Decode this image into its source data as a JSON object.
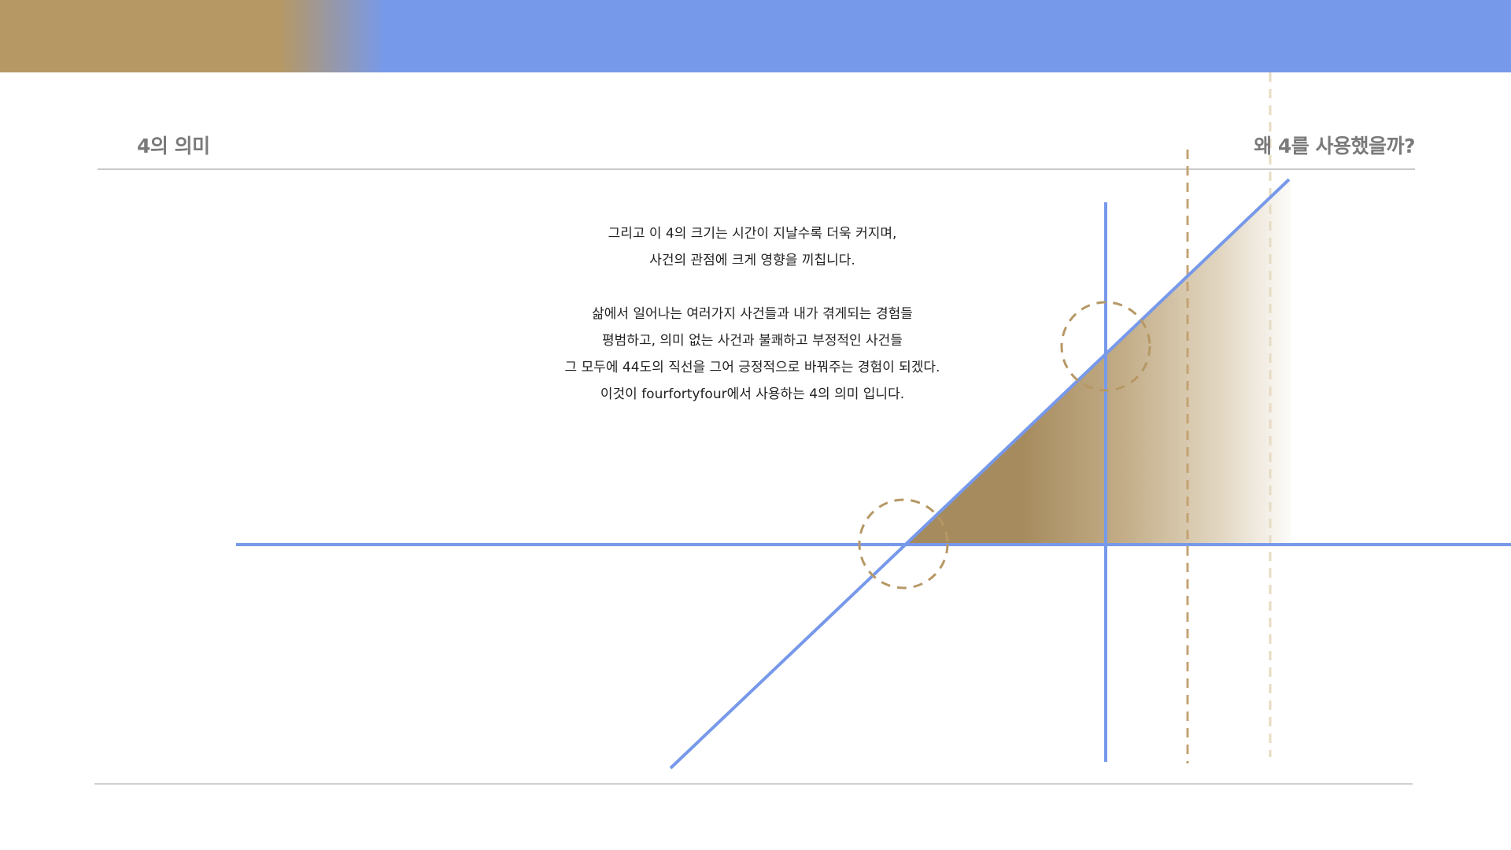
{
  "header": {
    "left_title": "4의 의미",
    "right_title": "왜 4를 사용했을까?"
  },
  "body": {
    "paragraphs": [
      {
        "lines": [
          "그리고 이 4의 크기는 시간이 지날수록 더욱 커지며,",
          "사건의 관점에 크게 영향을 끼칩니다."
        ]
      },
      {
        "lines": [
          "삶에서 일어나는 여러가지 사건들과 내가 겪게되는 경험들",
          "평범하고, 의미 없는 사건과 불쾌하고 부정적인 사건들",
          "그 모두에 44도의 직선을 그어 긍정적으로 바꿔주는 경험이 되겠다.",
          "이것이 fourfortyfour에서 사용하는 4의 의미 입니다."
        ]
      }
    ]
  },
  "colors": {
    "accent_blue": "#7799ea",
    "accent_gold": "#b69865",
    "rule_gray": "#c8c8c8",
    "dashed_gold": "#c4a373",
    "dashed_light": "#e7dcc2"
  }
}
